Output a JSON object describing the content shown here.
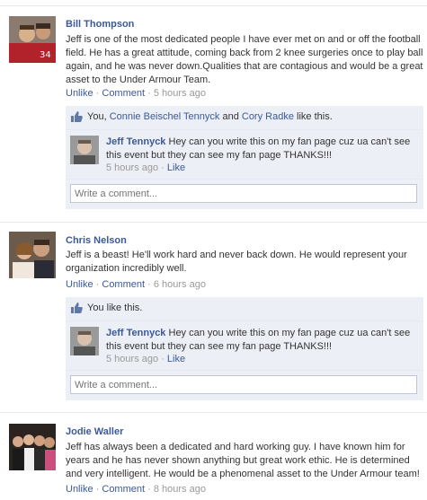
{
  "posts": [
    {
      "author": "Bill Thompson",
      "text": "Jeff is one of the most dedicated people I have ever met on and or off the football field. He has a great attitude, coming back from 2 knee surgeries once to play ball again, and he was never down.Qualities that are contagious and would be a great asset to the Under Armour Team.",
      "unlike": "Unlike",
      "comment": "Comment",
      "time": "5 hours ago",
      "likes": {
        "you": "You,",
        "person1": "Connie Beischel Tennyck",
        "and": "and",
        "person2": "Cory Radke",
        "suffix": "like this."
      },
      "reply": {
        "author": "Jeff Tennyck",
        "text": "Hey can you write this on my fan page cuz ua can't see this event but they can see my fan page THANKS!!!",
        "time": "5 hours ago",
        "like": "Like"
      },
      "comment_placeholder": "Write a comment..."
    },
    {
      "author": "Chris Nelson",
      "text": "Jeff is a beast! He'll work hard and never back down. He would represent your organization incredibly well.",
      "unlike": "Unlike",
      "comment": "Comment",
      "time": "6 hours ago",
      "likes": {
        "text": "You like this."
      },
      "reply": {
        "author": "Jeff Tennyck",
        "text": "Hey can you write this on my fan page cuz ua can't see this event but they can see my fan page THANKS!!!",
        "time": "5 hours ago",
        "like": "Like"
      },
      "comment_placeholder": "Write a comment..."
    },
    {
      "author": "Jodie Waller",
      "text": "Jeff has always been a dedicated and hard working guy. I have known him for years and he has never shown anything but great work ethic. He is determined and very intelligent. He would be a phenomenal asset to the Under Armour team!",
      "unlike": "Unlike",
      "comment": "Comment",
      "time": "8 hours ago"
    }
  ],
  "separator": "·",
  "icons": {
    "like": "thumbs-up-icon"
  },
  "colors": {
    "link": "#3b5998",
    "meta": "#999999",
    "box": "#eceff5"
  }
}
